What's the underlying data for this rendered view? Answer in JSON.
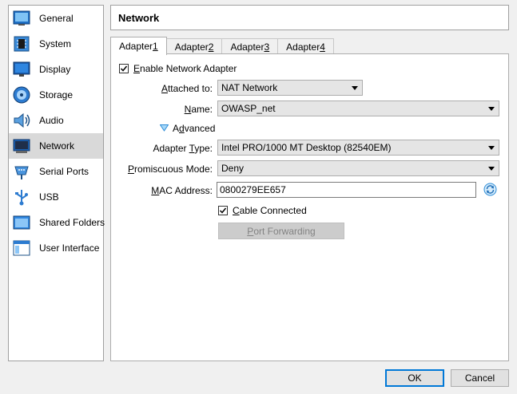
{
  "sidebar": {
    "items": [
      {
        "label": "General",
        "icon": "general-icon"
      },
      {
        "label": "System",
        "icon": "chip-icon"
      },
      {
        "label": "Display",
        "icon": "monitor-icon"
      },
      {
        "label": "Storage",
        "icon": "disk-icon"
      },
      {
        "label": "Audio",
        "icon": "speaker-icon"
      },
      {
        "label": "Network",
        "icon": "network-icon",
        "selected": true
      },
      {
        "label": "Serial Ports",
        "icon": "serial-port-icon"
      },
      {
        "label": "USB",
        "icon": "usb-icon"
      },
      {
        "label": "Shared Folders",
        "icon": "folder-icon"
      },
      {
        "label": "User Interface",
        "icon": "window-icon"
      }
    ]
  },
  "header": {
    "title": "Network"
  },
  "tabs": [
    {
      "label": "Adapter ",
      "key": "1",
      "active": true
    },
    {
      "label": "Adapter ",
      "key": "2"
    },
    {
      "label": "Adapter ",
      "key": "3"
    },
    {
      "label": "Adapter ",
      "key": "4"
    }
  ],
  "form": {
    "enable": {
      "pre": "",
      "key": "E",
      "post": "nable Network Adapter",
      "checked": true
    },
    "attached": {
      "pre": "",
      "key": "A",
      "post": "ttached to:",
      "value": "NAT Network"
    },
    "name": {
      "pre": "",
      "key": "N",
      "post": "ame:",
      "value": "OWASP_net"
    },
    "advanced": {
      "pre": "A",
      "key": "d",
      "post": "vanced"
    },
    "adapter_type": {
      "pre": "Adapter ",
      "key": "T",
      "post": "ype:",
      "value": "Intel PRO/1000 MT Desktop (82540EM)"
    },
    "promiscuous": {
      "pre": "",
      "key": "P",
      "post": "romiscuous Mode:",
      "value": "Deny"
    },
    "mac": {
      "pre": "",
      "key": "M",
      "post": "AC Address:",
      "value": "0800279EE657"
    },
    "cable": {
      "pre": "",
      "key": "C",
      "post": "able Connected",
      "checked": true
    },
    "port_forwarding": {
      "pre": "",
      "key": "P",
      "post": "ort Forwarding"
    }
  },
  "buttons": {
    "ok": "OK",
    "cancel": "Cancel"
  },
  "colors": {
    "accent": "#0078d7",
    "selected_bg": "#d9d9d9"
  }
}
